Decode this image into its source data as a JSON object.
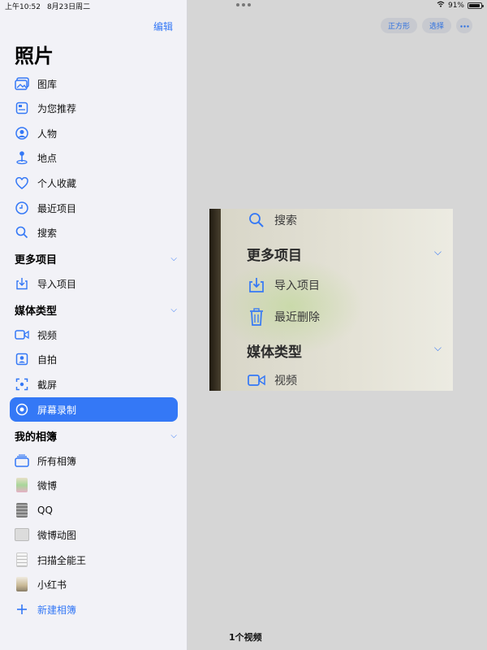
{
  "status": {
    "time": "上午10:52",
    "date": "8月23日周二",
    "battery": "91%",
    "battery_level": 0.91
  },
  "sidebar": {
    "edit_label": "编辑",
    "title": "照片",
    "items": [
      {
        "label": "图库",
        "icon": "photo-library-icon"
      },
      {
        "label": "为您推荐",
        "icon": "for-you-icon"
      },
      {
        "label": "人物",
        "icon": "people-icon"
      },
      {
        "label": "地点",
        "icon": "places-icon"
      },
      {
        "label": "个人收藏",
        "icon": "heart-icon"
      },
      {
        "label": "最近项目",
        "icon": "clock-icon"
      },
      {
        "label": "搜索",
        "icon": "search-icon"
      }
    ],
    "more_section": {
      "label": "更多项目",
      "items": [
        {
          "label": "导入项目",
          "icon": "import-icon"
        }
      ]
    },
    "media_section": {
      "label": "媒体类型",
      "items": [
        {
          "label": "视频",
          "icon": "video-icon"
        },
        {
          "label": "自拍",
          "icon": "selfie-icon"
        },
        {
          "label": "截屏",
          "icon": "screenshot-icon"
        },
        {
          "label": "屏幕录制",
          "icon": "screen-recording-icon",
          "selected": true
        }
      ]
    },
    "albums_section": {
      "label": "我的相簿",
      "items": [
        {
          "label": "所有相簿",
          "icon": "all-albums-icon"
        },
        {
          "label": "微博"
        },
        {
          "label": "QQ"
        },
        {
          "label": "微博动图"
        },
        {
          "label": "扫描全能王"
        },
        {
          "label": "小红书"
        }
      ]
    },
    "new_album": "新建相簿"
  },
  "toolbar": {
    "square_label": "正方形",
    "select_label": "选择",
    "more_icon": "ellipsis-icon"
  },
  "photo_content": {
    "search": "搜索",
    "more_section": "更多项目",
    "import": "导入项目",
    "recently_deleted": "最近删除",
    "media_section": "媒体类型",
    "video": "视频"
  },
  "footer": {
    "count": "1个视频"
  },
  "colors": {
    "accent": "#3478f6",
    "sidebar_bg": "#f2f2f7",
    "main_bg": "#d6d6d6"
  }
}
